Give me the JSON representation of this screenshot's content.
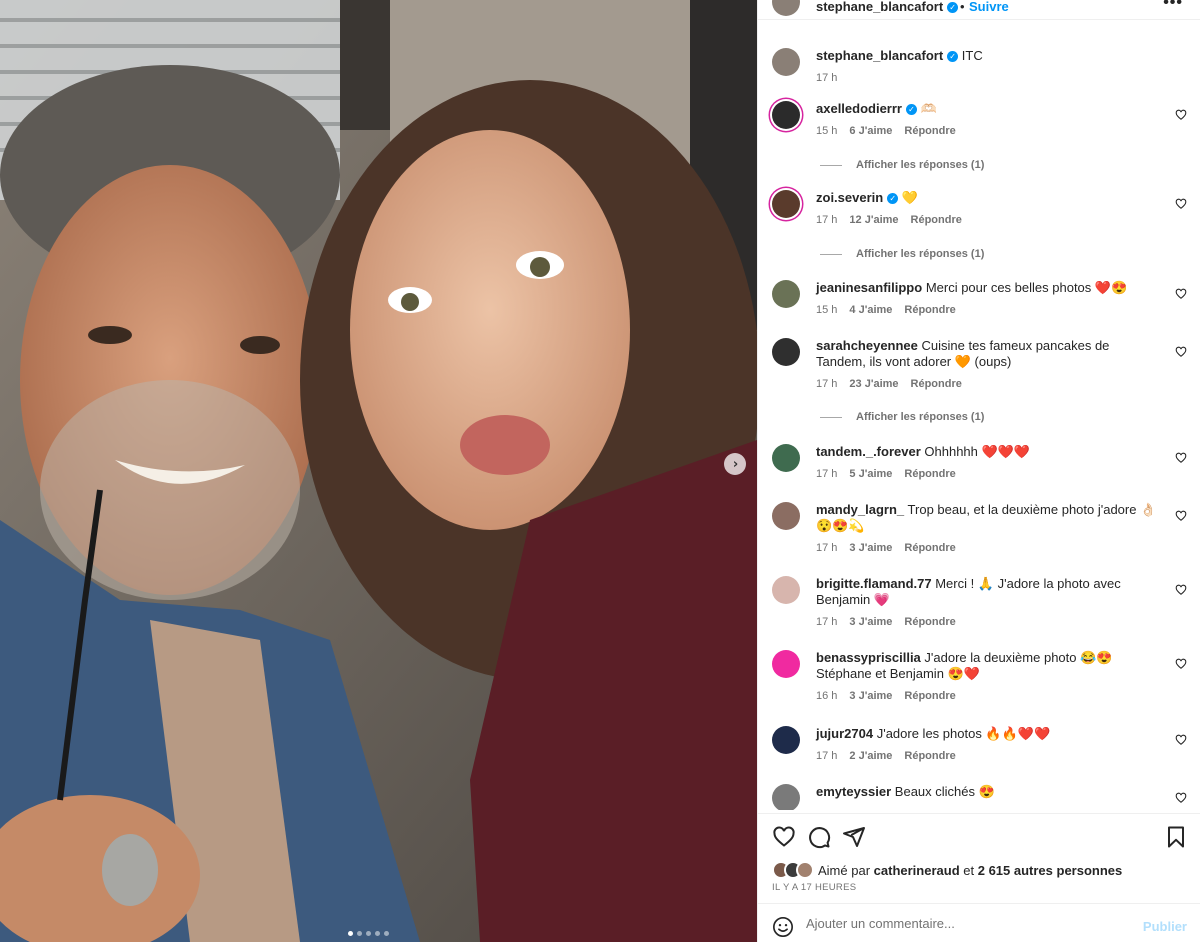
{
  "header": {
    "username": "stephane_blancafort",
    "separator": "•",
    "follow_label": "Suivre",
    "more_label": "•••"
  },
  "photo": {
    "carousel": {
      "count": 5,
      "active": 0
    },
    "next_label": "›"
  },
  "caption": {
    "username": "stephane_blancafort",
    "text": "ITC",
    "time": "17 h"
  },
  "comments": [
    {
      "username": "axelledodierrr",
      "verified": true,
      "text": "🫶🏻",
      "time": "15 h",
      "likes": "6 J'aime",
      "reply": "Répondre",
      "replies_label": "Afficher les réponses (1)",
      "avatar_color": "#2b2b2b"
    },
    {
      "username": "zoi.severin",
      "verified": true,
      "text": "💛",
      "time": "17 h",
      "likes": "12 J'aime",
      "reply": "Répondre",
      "replies_label": "Afficher les réponses (1)",
      "avatar_color": "#5a3b2c"
    },
    {
      "username": "jeaninesanfilippo",
      "verified": false,
      "text": "Merci pour ces belles photos ❤️😍",
      "time": "15 h",
      "likes": "4 J'aime",
      "reply": "Répondre",
      "replies_label": "",
      "avatar_color": "#6a7256"
    },
    {
      "username": "sarahcheyennee",
      "verified": false,
      "text": "Cuisine tes fameux pancakes de Tandem, ils vont adorer 🧡 (oups)",
      "time": "17 h",
      "likes": "23 J'aime",
      "reply": "Répondre",
      "replies_label": "Afficher les réponses (1)",
      "avatar_color": "#2f2f2f"
    },
    {
      "username": "tandem._.forever",
      "verified": false,
      "text": "Ohhhhhh ❤️❤️❤️",
      "time": "17 h",
      "likes": "5 J'aime",
      "reply": "Répondre",
      "replies_label": "",
      "avatar_color": "#3f6b4f"
    },
    {
      "username": "mandy_lagrn_",
      "verified": false,
      "text": "Trop beau, et la deuxième photo j'adore 👌🏻😯😍💫",
      "time": "17 h",
      "likes": "3 J'aime",
      "reply": "Répondre",
      "replies_label": "",
      "avatar_color": "#8b6d62"
    },
    {
      "username": "brigitte.flamand.77",
      "verified": false,
      "text": "Merci ! 🙏 J'adore la photo avec Benjamin 💗",
      "time": "17 h",
      "likes": "3 J'aime",
      "reply": "Répondre",
      "replies_label": "",
      "avatar_color": "#d7b5ad"
    },
    {
      "username": "benassypriscillia",
      "verified": false,
      "text": "J'adore la deuxième photo 😂😍 Stéphane et Benjamin 😍❤️",
      "time": "16 h",
      "likes": "3 J'aime",
      "reply": "Répondre",
      "replies_label": "",
      "avatar_color": "#f02aa0"
    },
    {
      "username": "jujur2704",
      "verified": false,
      "text": "J'adore les photos 🔥🔥❤️❤️",
      "time": "17 h",
      "likes": "2 J'aime",
      "reply": "Répondre",
      "replies_label": "",
      "avatar_color": "#1e2b4a"
    },
    {
      "username": "emyteyssier",
      "verified": false,
      "text": "Beaux clichés 😍",
      "time": "",
      "likes": "",
      "reply": "",
      "replies_label": "",
      "avatar_color": "#7a7a7a"
    }
  ],
  "actions": {
    "liked_by_prefix": "Aimé par",
    "liked_by_user": "catherineraud",
    "liked_by_and": "et",
    "liked_by_others": "2 615 autres personnes",
    "time_ago": "IL Y A 17 HEURES"
  },
  "add_comment": {
    "placeholder": "Ajouter un commentaire...",
    "post_label": "Publier"
  },
  "colors": {
    "accent": "#0095f6",
    "muted": "#737373",
    "post_disabled": "#b2dffc"
  }
}
